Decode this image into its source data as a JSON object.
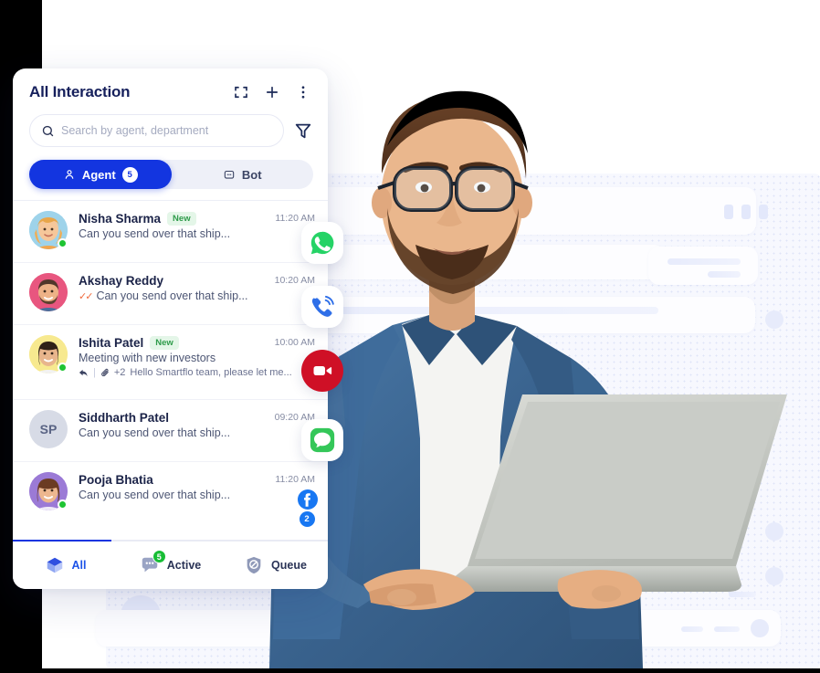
{
  "card": {
    "title": "All Interaction",
    "header_icons": [
      "expand-icon",
      "plus-icon",
      "more-vertical-icon"
    ],
    "search": {
      "placeholder": "Search by agent, department",
      "value": "",
      "icon": "search-icon",
      "filter_icon": "filter-icon"
    },
    "toggle": {
      "agent_label": "Agent",
      "agent_count": "5",
      "bot_label": "Bot",
      "active": "Agent"
    },
    "conversations": [
      {
        "name": "Nisha Sharma",
        "tag": "New",
        "time": "11:20 AM",
        "snippet": "Can you send over that ship...",
        "sub_snippet": "",
        "channel": "whatsapp",
        "online": true,
        "avatar_ring": "#8ecbe8",
        "initials": "",
        "read_tick": false,
        "attachments": ""
      },
      {
        "name": "Akshay Reddy",
        "tag": "",
        "time": "10:20 AM",
        "snippet": "Can you send over that ship...",
        "sub_snippet": "",
        "channel": "voice",
        "online": false,
        "avatar_ring": "#e8567f",
        "initials": "",
        "read_tick": true,
        "attachments": ""
      },
      {
        "name": "Ishita Patel",
        "tag": "New",
        "time": "10:00 AM",
        "snippet": "Meeting with new investors",
        "sub_snippet": "Hello Smartflo team, please let me...",
        "channel": "video",
        "online": true,
        "avatar_ring": "#f5e36b",
        "initials": "",
        "read_tick": false,
        "attachments": "+2"
      },
      {
        "name": "Siddharth Patel",
        "tag": "",
        "time": "09:20 AM",
        "snippet": "Can you send over that ship...",
        "sub_snippet": "",
        "channel": "sms",
        "online": false,
        "avatar_ring": "",
        "initials": "SP",
        "read_tick": false,
        "attachments": ""
      },
      {
        "name": "Pooja Bhatia",
        "tag": "",
        "time": "11:20 AM",
        "snippet": "Can you send over that ship...",
        "sub_snippet": "",
        "channel": "facebook",
        "online": true,
        "avatar_ring": "#9b7ad6",
        "initials": "",
        "read_tick": false,
        "attachments": "",
        "unread_count": "2"
      }
    ],
    "bottom_nav": [
      {
        "label": "All",
        "icon": "cube-icon",
        "badge": "",
        "active": true
      },
      {
        "label": "Active",
        "icon": "chat-bubble-icon",
        "badge": "5",
        "active": false
      },
      {
        "label": "Queue",
        "icon": "shield-clock-icon",
        "badge": "",
        "active": false
      }
    ]
  },
  "colors": {
    "accent": "#1335e0",
    "nav_active": "#1d53e8",
    "online": "#1ec432",
    "badge_green": "#17bd35",
    "tag_new_text": "#2e9b4a",
    "tag_new_bg": "#e4f6e8",
    "whatsapp": "#25d366",
    "voice": "#2f6fe8",
    "video": "#cf1026",
    "sms": "#34c759",
    "facebook": "#1877f2",
    "tick": "#f06a3c"
  }
}
